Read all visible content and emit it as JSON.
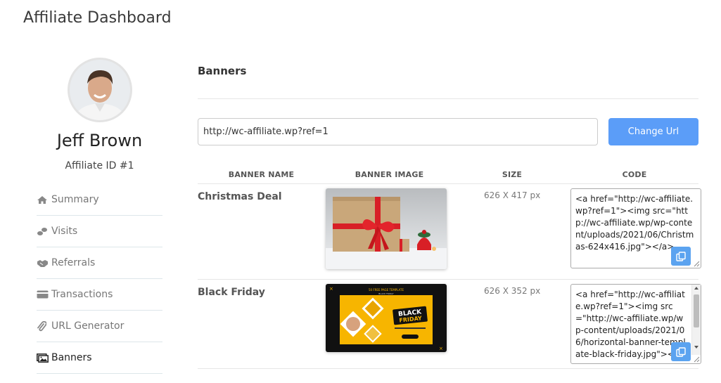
{
  "page": {
    "title": "Affiliate Dashboard"
  },
  "profile": {
    "name": "Jeff Brown",
    "affiliate_id": "Affiliate ID #1"
  },
  "nav": {
    "items": [
      {
        "label": "Summary",
        "icon": "home-icon"
      },
      {
        "label": "Visits",
        "icon": "footsteps-icon"
      },
      {
        "label": "Referrals",
        "icon": "handshake-icon"
      },
      {
        "label": "Transactions",
        "icon": "credit-card-icon"
      },
      {
        "label": "URL Generator",
        "icon": "paperclip-icon"
      },
      {
        "label": "Banners",
        "icon": "images-icon",
        "active": true
      }
    ]
  },
  "main": {
    "section_title": "Banners",
    "url_value": "http://wc-affiliate.wp?ref=1",
    "change_button": "Change Url",
    "columns": [
      "BANNER NAME",
      "BANNER IMAGE",
      "SIZE",
      "CODE"
    ],
    "banners": [
      {
        "name": "Christmas Deal",
        "size": "626 X 417 px",
        "code": "<a href=\"http://wc-affiliate.wp?ref=1\"><img src=\"http://wc-affiliate.wp/wp-content/uploads/2021/06/Christmas-624x416.jpg\"></a>"
      },
      {
        "name": "Black Friday",
        "size": "626 X 352 px",
        "code": "<a href=\"http://wc-affiliate.wp?ref=1\"><img src=\"http://wc-affiliate.wp/wp-content/uploads/2021/06/horizontal-banner-template-black-friday.jpg\"></a>",
        "image_text": {
          "top": "50 FREE PAGE TEMPLATE",
          "sub": "BLACK FRIDAY",
          "headline_1": "BLACK",
          "headline_2": "FRIDAY"
        }
      }
    ]
  },
  "colors": {
    "primary_button": "#5b9df8",
    "copy_button": "#5ba3f0",
    "black_friday_yellow": "#f7b500"
  }
}
